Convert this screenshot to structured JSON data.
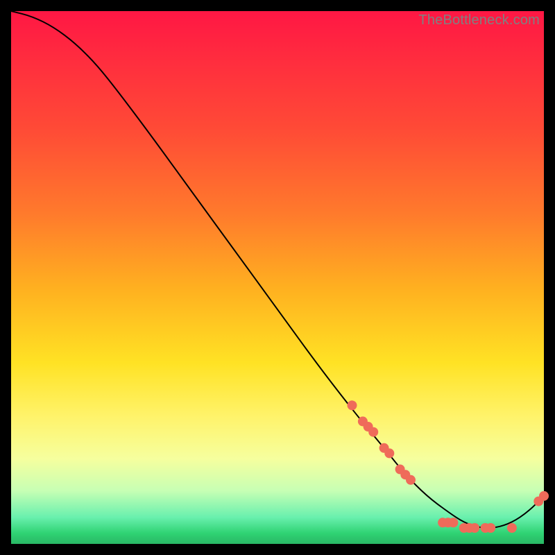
{
  "watermark": "TheBottleneck.com",
  "chart_data": {
    "type": "line",
    "title": "",
    "xlabel": "",
    "ylabel": "",
    "xlim": [
      0,
      100
    ],
    "ylim": [
      0,
      100
    ],
    "grid": false,
    "legend": false,
    "series": [
      {
        "name": "curve",
        "x": [
          0,
          4,
          8,
          12,
          16,
          20,
          26,
          34,
          42,
          50,
          58,
          65,
          70,
          74,
          78,
          82,
          85,
          88,
          91,
          94,
          97,
          100
        ],
        "y": [
          100,
          99,
          97,
          94,
          90,
          85,
          77,
          66,
          55,
          44,
          33,
          24,
          18,
          13,
          9,
          6,
          4,
          3,
          3,
          4,
          6,
          9
        ],
        "color": "#000000",
        "line_width": 2
      }
    ],
    "markers": [
      {
        "x": 64,
        "y": 26
      },
      {
        "x": 66,
        "y": 23
      },
      {
        "x": 67,
        "y": 22
      },
      {
        "x": 68,
        "y": 21
      },
      {
        "x": 70,
        "y": 18
      },
      {
        "x": 71,
        "y": 17
      },
      {
        "x": 73,
        "y": 14
      },
      {
        "x": 74,
        "y": 13
      },
      {
        "x": 75,
        "y": 12
      },
      {
        "x": 81,
        "y": 4
      },
      {
        "x": 82,
        "y": 4
      },
      {
        "x": 83,
        "y": 4
      },
      {
        "x": 85,
        "y": 3
      },
      {
        "x": 86,
        "y": 3
      },
      {
        "x": 87,
        "y": 3
      },
      {
        "x": 89,
        "y": 3
      },
      {
        "x": 90,
        "y": 3
      },
      {
        "x": 94,
        "y": 3
      },
      {
        "x": 99,
        "y": 8
      },
      {
        "x": 100,
        "y": 9
      }
    ],
    "marker_style": {
      "color": "#ef6b5a",
      "radius_px": 7
    }
  }
}
